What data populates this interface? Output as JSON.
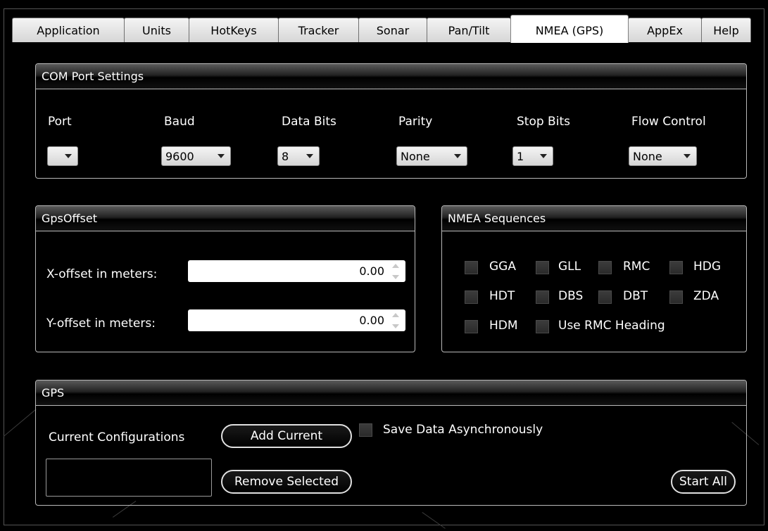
{
  "tabs": [
    "Application",
    "Units",
    "HotKeys",
    "Tracker",
    "Sonar",
    "Pan/Tilt",
    "NMEA (GPS)",
    "AppEx",
    "Help"
  ],
  "active_tab": "NMEA (GPS)",
  "com_port": {
    "title": "COM Port Settings",
    "labels": {
      "port": "Port",
      "baud": "Baud",
      "data_bits": "Data Bits",
      "parity": "Parity",
      "stop_bits": "Stop Bits",
      "flow": "Flow Control"
    },
    "values": {
      "port": "",
      "baud": "9600",
      "data_bits": "8",
      "parity": "None",
      "stop_bits": "1",
      "flow": "None"
    }
  },
  "gps_offset": {
    "title": "GpsOffset",
    "x_label": "X-offset in meters:",
    "x_value": "0.00",
    "y_label": "Y-offset in meters:",
    "y_value": "0.00"
  },
  "nmea": {
    "title": "NMEA Sequences",
    "items": [
      "GGA",
      "GLL",
      "RMC",
      "HDG",
      "HDT",
      "DBS",
      "DBT",
      "ZDA",
      "HDM",
      "Use RMC Heading"
    ]
  },
  "gps": {
    "title": "GPS",
    "current_configs_label": "Current Configurations",
    "add_current": "Add Current",
    "remove_selected": "Remove Selected",
    "save_async": "Save Data Asynchronously",
    "start_all": "Start All"
  }
}
